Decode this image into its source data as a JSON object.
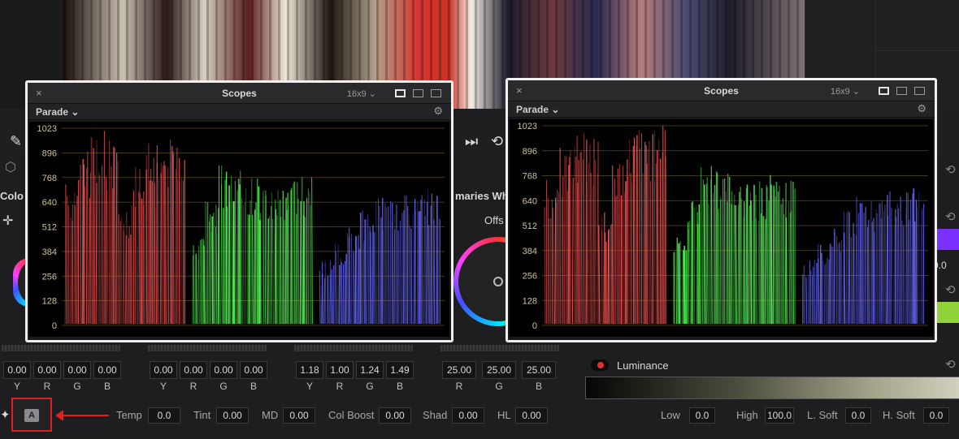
{
  "viewer": {
    "timeline_label": ""
  },
  "transport": {
    "skip_end_icon": "skip-end-icon",
    "loop_icon": "loop-icon",
    "eyedropper_icon": "eyedropper-icon",
    "crosshair_icon": "crosshair-icon"
  },
  "panels": {
    "color_label": "Colo",
    "primaries_label": "maries Whe",
    "offset_label": "Offs"
  },
  "wheel_groups": [
    {
      "values": [
        "0.00",
        "0.00",
        "0.00",
        "0.00"
      ],
      "labels": [
        "Y",
        "R",
        "G",
        "B"
      ]
    },
    {
      "values": [
        "0.00",
        "0.00",
        "0.00",
        "0.00"
      ],
      "labels": [
        "Y",
        "R",
        "G",
        "B"
      ]
    },
    {
      "values": [
        "1.18",
        "1.00",
        "1.24",
        "1.49"
      ],
      "labels": [
        "Y",
        "R",
        "G",
        "B"
      ]
    },
    {
      "values": [
        "25.00",
        "25.00",
        "25.00"
      ],
      "labels": [
        "R",
        "G",
        "B"
      ]
    }
  ],
  "auto_button": {
    "label": "A"
  },
  "params": {
    "temp_label": "Temp",
    "temp_value": "0.0",
    "tint_label": "Tint",
    "tint_value": "0.00",
    "md_label": "MD",
    "md_value": "0.00",
    "colboost_label": "Col Boost",
    "colboost_value": "0.00",
    "shad_label": "Shad",
    "shad_value": "0.00",
    "hl_label": "HL",
    "hl_value": "0.00"
  },
  "luminance": {
    "label": "Luminance",
    "low_label": "Low",
    "low_value": "0.0",
    "high_label": "High",
    "high_value": "100.0",
    "lsoft_label": "L. Soft",
    "lsoft_value": "0.0",
    "hsoft_label": "H. Soft",
    "hsoft_value": "0.0",
    "partial_value": "0.0"
  },
  "swatches": {
    "purple": "#7b30ff",
    "green": "#8fd23a",
    "red_accent": "#e02020"
  },
  "scopes": [
    {
      "title": "Scopes",
      "aspect": "16x9",
      "mode": "Parade",
      "ticks": [
        "1023",
        "896",
        "768",
        "640",
        "512",
        "384",
        "256",
        "128",
        "0"
      ]
    },
    {
      "title": "Scopes",
      "aspect": "16x9",
      "mode": "Parade",
      "ticks": [
        "1023",
        "896",
        "768",
        "640",
        "512",
        "384",
        "256",
        "128",
        "0"
      ]
    }
  ]
}
